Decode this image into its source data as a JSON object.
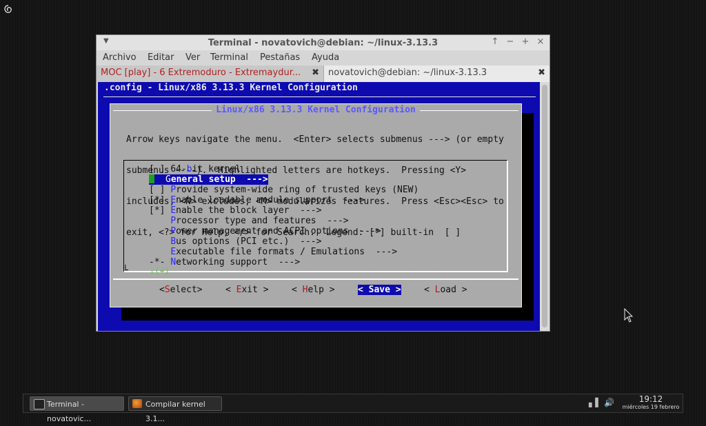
{
  "desktop": {
    "logo_icon": "debian-swirl-icon"
  },
  "window": {
    "title": "Terminal - novatovich@debian: ~/linux-3.13.3",
    "controls": {
      "up": "↑",
      "minimize": "−",
      "maximize": "+",
      "close": "×"
    },
    "menu": [
      "Archivo",
      "Editar",
      "Ver",
      "Terminal",
      "Pestañas",
      "Ayuda"
    ],
    "tabs": [
      {
        "label": "MOC [play] - 6 Extremoduro - Extremaydur...",
        "close": "✖"
      },
      {
        "label": "novatovich@debian: ~/linux-3.13.3",
        "close": "✖"
      }
    ]
  },
  "terminal": {
    "config_title": ".config - Linux/x86 3.13.3 Kernel Configuration",
    "dialog_title": "Linux/x86 3.13.3 Kernel Configuration",
    "help_lines": [
      "Arrow keys navigate the menu.  <Enter> selects submenus ---> (or empty",
      "submenus ----).  Highlighted letters are hotkeys.  Pressing <Y>",
      "includes, <N> excludes, <M> modularizes features.  Press <Esc><Esc> to",
      "exit, <?> for Help, </> for Search.  Legend: [*] built-in  [ ]"
    ],
    "menu_items": [
      {
        "prefix": "[ ] ",
        "pre": "64-",
        "hot": "b",
        "rest": "it kernel"
      },
      {
        "prefix": "",
        "pre": "",
        "hot": "G",
        "rest": "eneral setup  --->",
        "selected": true
      },
      {
        "prefix": "[ ] ",
        "pre": "",
        "hot": "P",
        "rest": "rovide system-wide ring of trusted keys (NEW)"
      },
      {
        "prefix": "[*] ",
        "pre": "",
        "hot": "E",
        "rest": "nable loadable module support  --->"
      },
      {
        "prefix": "[*] ",
        "pre": "",
        "hot": "E",
        "rest": "nable the block layer  --->"
      },
      {
        "prefix": "    ",
        "pre": "",
        "hot": "P",
        "rest": "rocessor type and features  --->"
      },
      {
        "prefix": "    ",
        "pre": "",
        "hot": "P",
        "rest": "ower management and ACPI options  --->"
      },
      {
        "prefix": "    ",
        "pre": "",
        "hot": "B",
        "rest": "us options (PCI etc.)  --->"
      },
      {
        "prefix": "    ",
        "pre": "",
        "hot": "E",
        "rest": "xecutable file formats / Emulations  --->"
      },
      {
        "prefix": "-*- ",
        "pre": "",
        "hot": "N",
        "rest": "etworking support  --->"
      }
    ],
    "more_indicator": "↓(+)",
    "buttons": [
      {
        "open": "<",
        "hot": "S",
        "rest": "elect",
        "close": ">"
      },
      {
        "open": "< ",
        "hot": "E",
        "rest": "xit",
        "close": " >"
      },
      {
        "open": "< ",
        "hot": "H",
        "rest": "elp",
        "close": " >"
      },
      {
        "open": "< ",
        "hot": "S",
        "rest": "ave",
        "close": " >",
        "active": true
      },
      {
        "open": "< ",
        "hot": "L",
        "rest": "oad",
        "close": " >"
      }
    ]
  },
  "taskbar": {
    "tasks": [
      {
        "label": "Terminal - novatovic...",
        "icon": "terminal-icon"
      },
      {
        "label": "Compilar kernel 3.1...",
        "icon": "firefox-icon"
      }
    ],
    "tray": {
      "network_icon": "network-signal-icon",
      "volume_icon": "volume-icon"
    },
    "clock": {
      "time": "19:12",
      "date": "miércoles 19 febrero"
    }
  }
}
